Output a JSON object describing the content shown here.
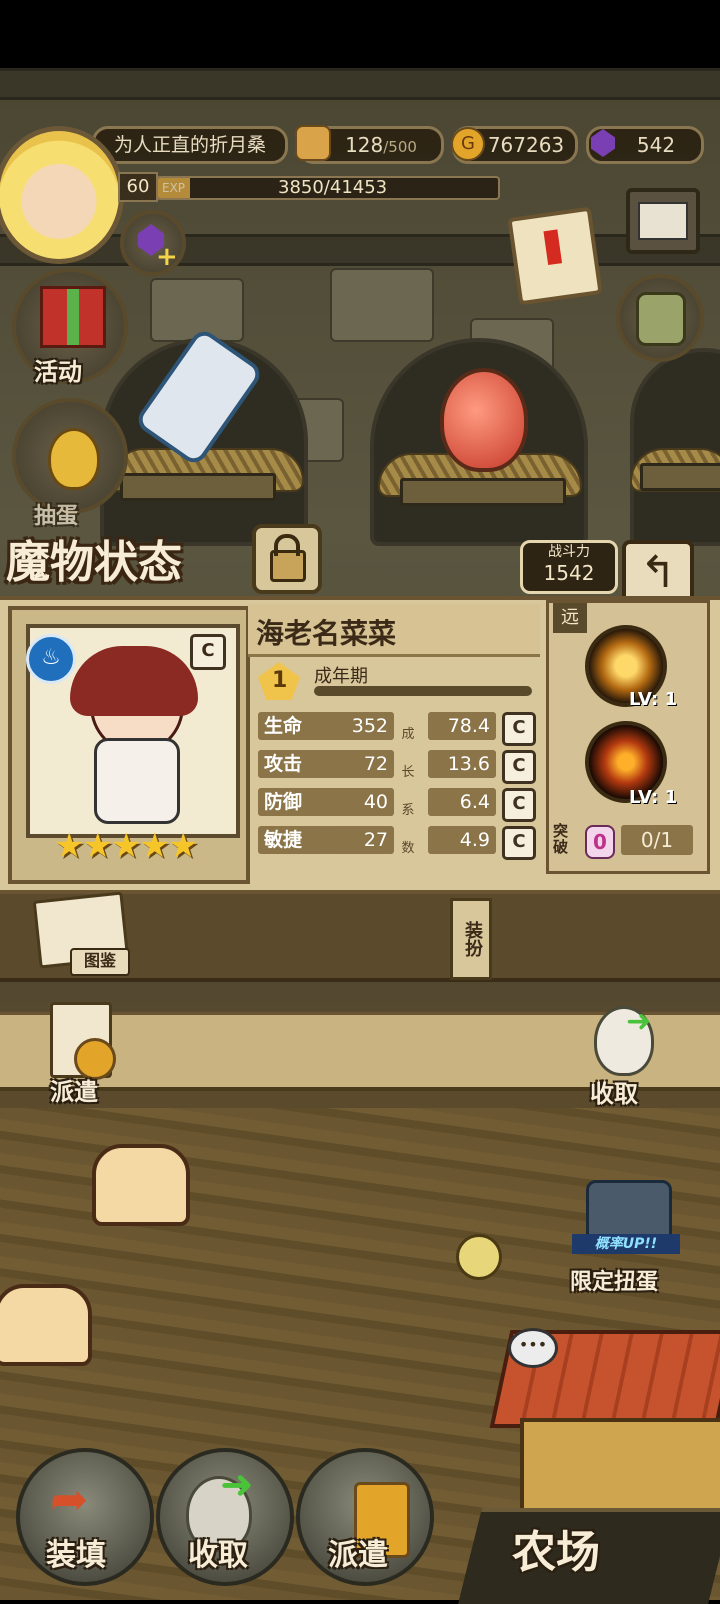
{
  "hud": {
    "player_name": "为人正直的折月桑",
    "stamina": "128",
    "stamina_max": "/500",
    "gold": "767263",
    "gems": "542",
    "level": "60",
    "exp_label": "EXP",
    "exp_text": "3850/41453",
    "exp_fraction": 0.093
  },
  "left_menu": {
    "activity": "活动",
    "gacha": "抽蛋"
  },
  "monster_panel": {
    "title": "魔物状态",
    "power_label": "战斗力",
    "power_value": "1542",
    "name": "海老名菜菜",
    "element_icon": "water-steam-icon",
    "grade_badge": "C",
    "stage_number": "1",
    "stage_label": "成年期",
    "stars": 5,
    "range_tag": "远",
    "growth_label_chars": [
      "成",
      "长",
      "系",
      "数"
    ],
    "stats": [
      {
        "name": "生命",
        "value": "352",
        "growth": "78.4",
        "grade": "C"
      },
      {
        "name": "攻击",
        "value": "72",
        "growth": "13.6",
        "grade": "C"
      },
      {
        "name": "防御",
        "value": "40",
        "growth": "6.4",
        "grade": "C"
      },
      {
        "name": "敏捷",
        "value": "27",
        "growth": "4.9",
        "grade": "C"
      }
    ],
    "skills": [
      {
        "icon": "radiant-fist-icon",
        "level": "LV: 1"
      },
      {
        "icon": "flaming-sword-icon",
        "level": "LV: 1"
      }
    ],
    "breakthrough_label": "突破",
    "breakthrough_count": "0",
    "breakthrough_progress": "0/1"
  },
  "mid_menu": {
    "encyclopedia": "图鉴",
    "dress_up": "装扮",
    "dispatch": "派遣",
    "collect": "收取",
    "limited_gacha": "限定扭蛋",
    "limited_banner": "概率UP!!"
  },
  "bottom_bar": {
    "load": "装填",
    "collect": "收取",
    "dispatch": "派遣",
    "farm": "农场"
  }
}
